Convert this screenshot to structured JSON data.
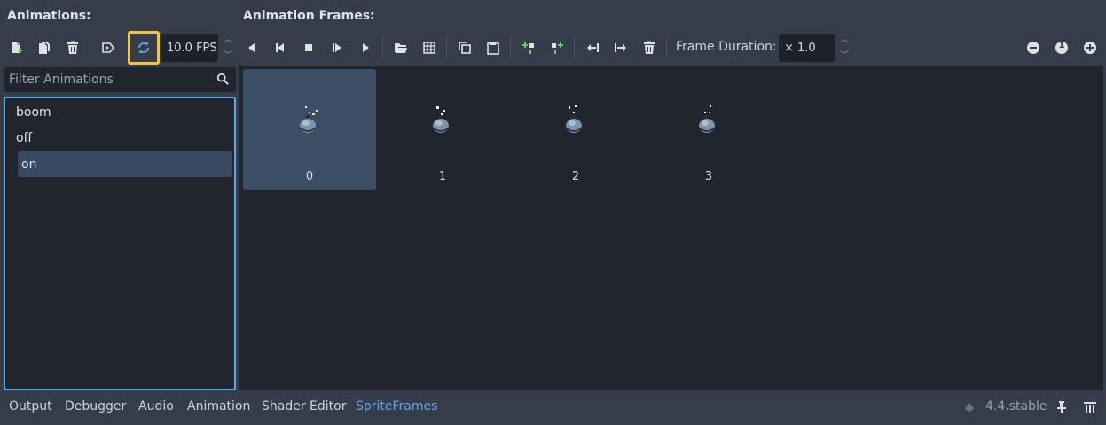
{
  "headers": {
    "animations": "Animations:",
    "frames": "Animation Frames:"
  },
  "toolbar": {
    "fps_value": "10.0 FPS",
    "frame_duration_label": "Frame Duration:",
    "frame_duration_value": "× 1.0",
    "zoom_reset_label": "1"
  },
  "filter": {
    "placeholder": "Filter Animations"
  },
  "animations": [
    {
      "name": "boom",
      "selected": false
    },
    {
      "name": "off",
      "selected": false
    },
    {
      "name": "on",
      "selected": true
    }
  ],
  "frames": [
    {
      "label": "0",
      "selected": true
    },
    {
      "label": "1",
      "selected": false
    },
    {
      "label": "2",
      "selected": false
    },
    {
      "label": "3",
      "selected": false
    }
  ],
  "bottom_tabs": [
    {
      "label": "Output",
      "active": false
    },
    {
      "label": "Debugger",
      "active": false
    },
    {
      "label": "Audio",
      "active": false
    },
    {
      "label": "Animation",
      "active": false
    },
    {
      "label": "Shader Editor",
      "active": false
    },
    {
      "label": "SpriteFrames",
      "active": true
    }
  ],
  "version": "4.4.stable",
  "colors": {
    "accent": "#62a6e8",
    "highlight": "#f5c542",
    "add_icon": "#5fd35f"
  }
}
